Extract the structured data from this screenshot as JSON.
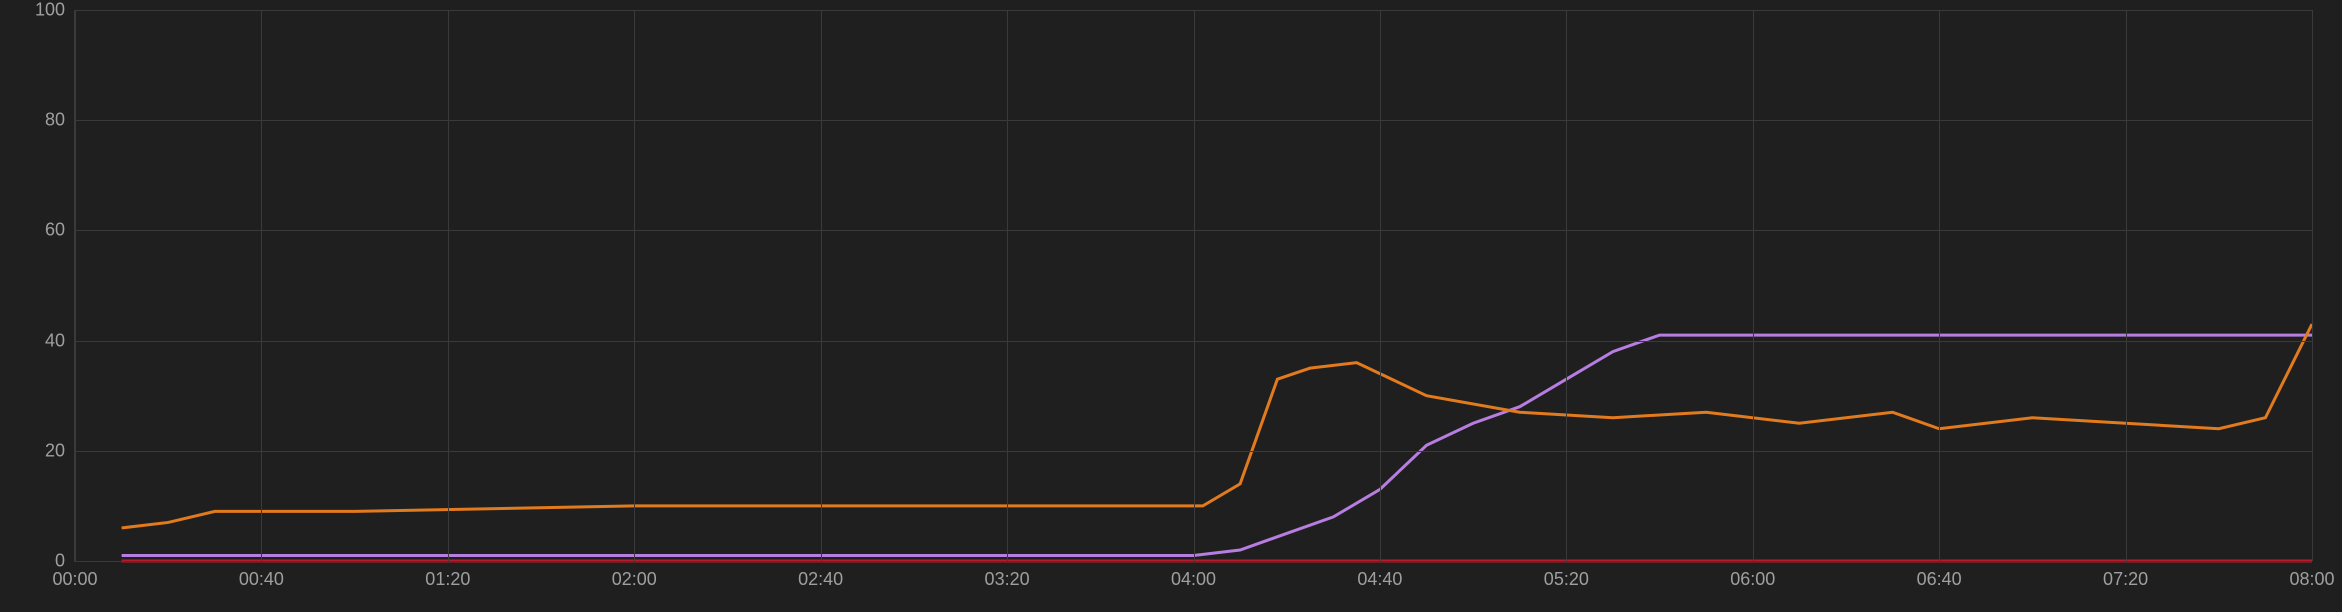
{
  "chart_data": {
    "type": "line",
    "title": "",
    "xlabel": "",
    "ylabel": "",
    "ylim": [
      0,
      100
    ],
    "xlim_minutes": [
      0,
      480
    ],
    "y_ticks": [
      0,
      20,
      40,
      60,
      80,
      100
    ],
    "x_ticks_minutes": [
      0,
      40,
      80,
      120,
      160,
      200,
      240,
      280,
      320,
      360,
      400,
      440,
      480
    ],
    "x_tick_labels": [
      "00:00",
      "00:40",
      "01:20",
      "02:00",
      "02:40",
      "03:20",
      "04:00",
      "04:40",
      "05:20",
      "06:00",
      "06:40",
      "07:20",
      "08:00"
    ],
    "grid": true,
    "legend": null,
    "series": [
      {
        "name": "red",
        "color": "#b71c2a",
        "x_minutes": [
          10,
          480
        ],
        "values": [
          0,
          0
        ]
      },
      {
        "name": "purple",
        "color": "#b77de0",
        "x_minutes": [
          10,
          240,
          250,
          260,
          270,
          280,
          290,
          300,
          310,
          320,
          330,
          340,
          480
        ],
        "values": [
          1,
          1,
          2,
          5,
          8,
          13,
          21,
          25,
          28,
          33,
          38,
          41,
          41
        ]
      },
      {
        "name": "orange",
        "color": "#e27a1e",
        "x_minutes": [
          10,
          20,
          30,
          60,
          120,
          180,
          238,
          242,
          250,
          258,
          265,
          275,
          290,
          310,
          330,
          350,
          370,
          390,
          400,
          420,
          440,
          460,
          470,
          480
        ],
        "values": [
          6,
          7,
          9,
          9,
          10,
          10,
          10,
          10,
          14,
          33,
          35,
          36,
          30,
          27,
          26,
          27,
          25,
          27,
          24,
          26,
          25,
          24,
          26,
          43
        ]
      }
    ]
  }
}
